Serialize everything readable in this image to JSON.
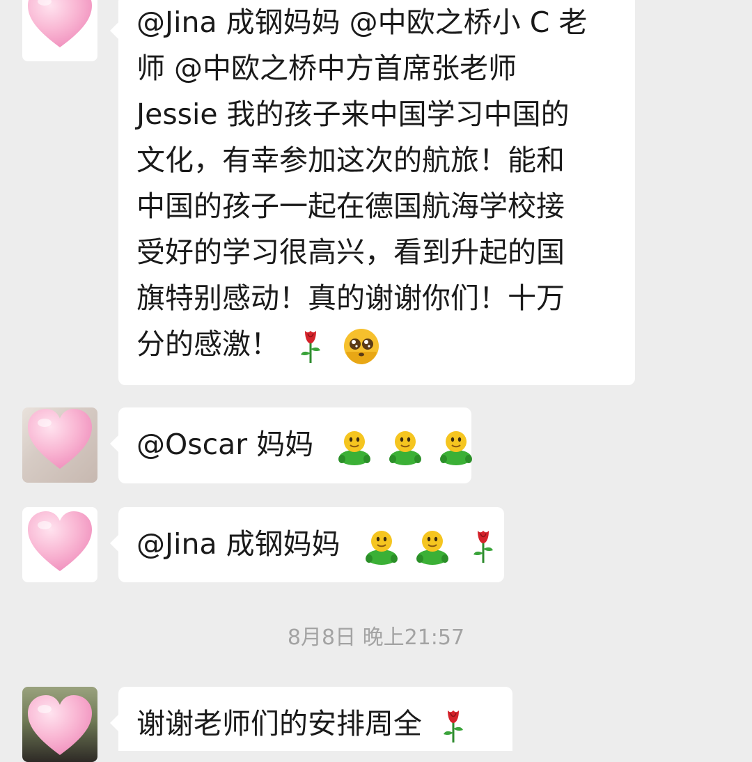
{
  "messages": [
    {
      "lines": [
        "@Jina 成钢妈妈  @中欧之桥小 C 老",
        "师  @中欧之桥中方首席张老师",
        "Jessie  我的孩子来中国学习中国的",
        "文化，有幸参加这次的航旅！能和",
        "中国的孩子一起在德国航海学校接",
        "受好的学习很高兴，看到升起的国",
        "旗特别感动！真的谢谢你们！十万",
        "分的感激！"
      ],
      "emojis": [
        "rose-emoji",
        "teary-face-emoji"
      ]
    },
    {
      "text": "@Oscar 妈妈",
      "emojis": [
        "green-figure-emoji",
        "green-figure-emoji",
        "green-figure-emoji"
      ]
    },
    {
      "text": "@Jina 成钢妈妈",
      "emojis": [
        "green-figure-emoji",
        "green-figure-emoji",
        "rose-emoji"
      ]
    },
    {
      "text": "谢谢老师们的安排周全",
      "emojis": [
        "rose-emoji"
      ]
    }
  ],
  "timestamp": "8月8日 晚上21:57",
  "colors": {
    "background": "#ededed",
    "bubble": "#ffffff",
    "timestamp_text": "#a3a3a3",
    "heart": "#f9b6d3"
  }
}
